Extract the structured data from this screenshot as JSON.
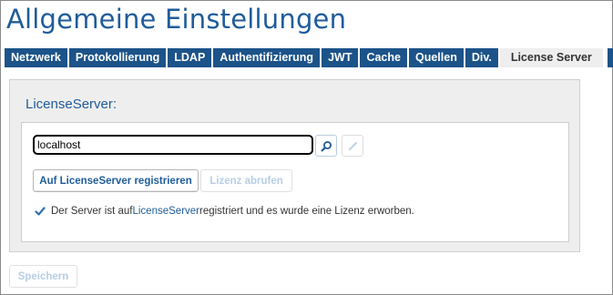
{
  "page": {
    "title": "Allgemeine Einstellungen"
  },
  "tabs": [
    {
      "label": "Netzwerk"
    },
    {
      "label": "Protokollierung"
    },
    {
      "label": "LDAP"
    },
    {
      "label": "Authentifizierung"
    },
    {
      "label": "JWT"
    },
    {
      "label": "Cache"
    },
    {
      "label": "Quellen"
    },
    {
      "label": "Div."
    },
    {
      "label": "License Server",
      "active": true
    }
  ],
  "license_server": {
    "section_title": "LicenseServer:",
    "server_input_value": "localhost",
    "search_icon": "search-icon",
    "edit_icon": "pencil-icon",
    "register_button": "Auf LicenseServer registrieren",
    "fetch_license_button": "Lizenz abrufen",
    "status": {
      "icon": "checkmark-icon",
      "text_before": "Der Server ist auf ",
      "link_text": "LicenseServer",
      "text_after": " registriert und es wurde eine Lizenz erworben."
    }
  },
  "footer": {
    "save_button": "Speichern"
  },
  "colors": {
    "accent": "#1f5c9a",
    "tabbar": "#1c5389",
    "panel": "#eeeeee",
    "disabled_text": "#b7cde4"
  }
}
